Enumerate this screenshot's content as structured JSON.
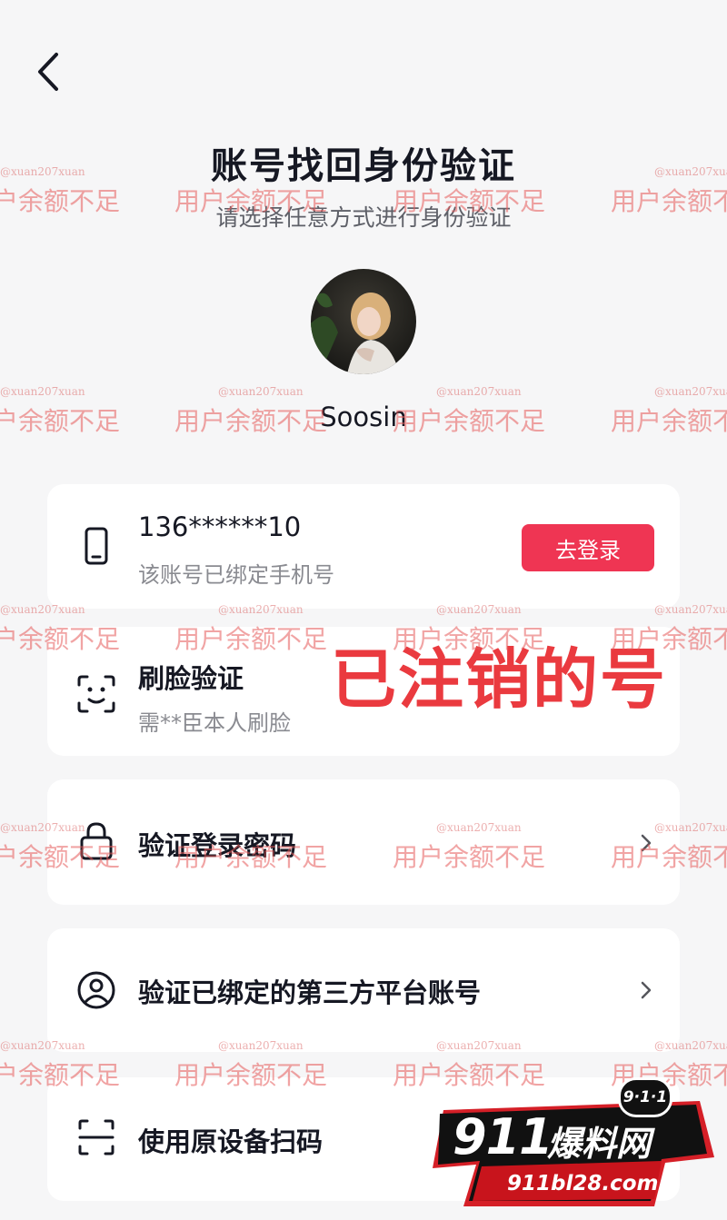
{
  "header": {
    "title": "账号找回身份验证",
    "subtitle": "请选择任意方式进行身份验证"
  },
  "profile": {
    "username": "Soosin"
  },
  "options": {
    "phone": {
      "number": "136******10",
      "desc": "该账号已绑定手机号",
      "button": "去登录"
    },
    "face": {
      "title": "刷脸验证",
      "desc": "需**臣本人刷脸"
    },
    "password": {
      "title": "验证登录密码"
    },
    "third_party": {
      "title": "验证已绑定的第三方平台账号"
    },
    "scan": {
      "title": "使用原设备扫码"
    }
  },
  "overlay_text": "已注销的号",
  "watermark": {
    "text": "用户余额不足",
    "small_text": "@xuan207xuan"
  },
  "logo": {
    "badge": "9·1·1",
    "number": "911",
    "name": "爆料网",
    "url": "911bl28.com"
  },
  "colors": {
    "accent": "#ef3553",
    "overlay": "#ea3a3f",
    "background": "#f6f6f7"
  },
  "icons": [
    "back-arrow-icon",
    "phone-icon",
    "face-scan-icon",
    "lock-icon",
    "user-circle-icon",
    "scan-icon",
    "chevron-right-icon"
  ]
}
